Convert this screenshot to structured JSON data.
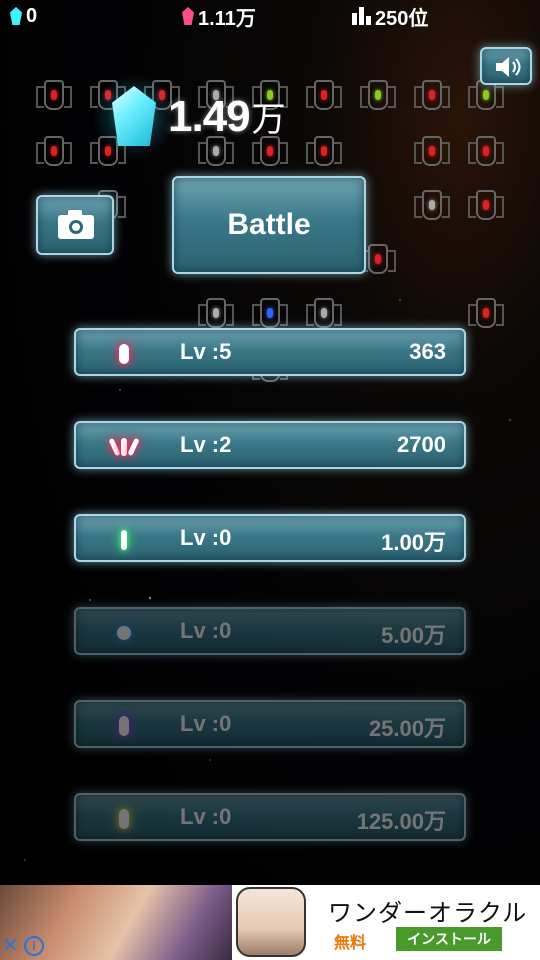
{
  "topbar": {
    "gems_cyan": "0",
    "gems_pink": "1.11万",
    "rank": "250位"
  },
  "main": {
    "score_value": "1.49",
    "score_unit": "万",
    "battle_label": "Battle"
  },
  "upgrades": [
    {
      "level": "Lv :5",
      "cost": "363",
      "icon": "red-pill-icon",
      "color": "#ff2a55",
      "locked": false
    },
    {
      "level": "Lv :2",
      "cost": "2700",
      "icon": "triple-shot-icon",
      "color": "#ff2a55",
      "locked": false
    },
    {
      "level": "Lv :0",
      "cost": "1.00万",
      "icon": "green-laser-icon",
      "color": "#3cff6a",
      "locked": false
    },
    {
      "level": "Lv :0",
      "cost": "5.00万",
      "icon": "blue-orb-icon",
      "color": "#3a8cff",
      "locked": true
    },
    {
      "level": "Lv :0",
      "cost": "25.00万",
      "icon": "purple-pill-icon",
      "color": "#a040ff",
      "locked": true
    },
    {
      "level": "Lv :0",
      "cost": "125.00万",
      "icon": "yellow-drop-icon",
      "color": "#e8e040",
      "locked": true
    }
  ],
  "ad": {
    "title": "ワンダーオラクル",
    "free_label": "無料",
    "install_label": "インストール",
    "close_glyph": "✕",
    "info_glyph": "i"
  },
  "colors": {
    "cyan_gem": "#3ff0ff",
    "pink_gem": "#ff4d8c",
    "panel": "#3a7888"
  }
}
